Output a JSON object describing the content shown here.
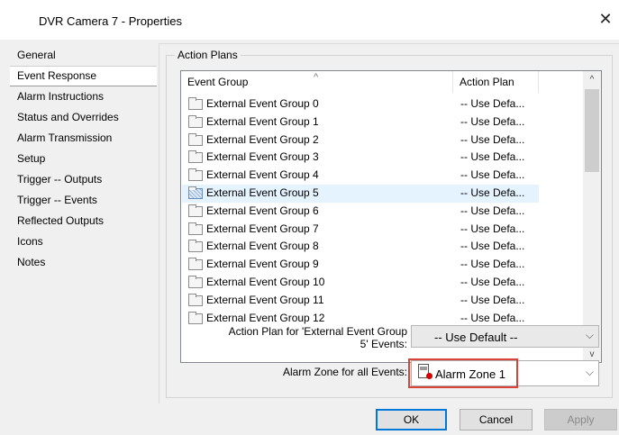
{
  "window": {
    "title": "DVR Camera 7 - Properties",
    "close_label": "✕"
  },
  "nav": {
    "items": [
      {
        "label": "General"
      },
      {
        "label": "Event Response"
      },
      {
        "label": "Alarm Instructions"
      },
      {
        "label": "Status and Overrides"
      },
      {
        "label": "Alarm Transmission"
      },
      {
        "label": "Setup"
      },
      {
        "label": "Trigger -- Outputs"
      },
      {
        "label": "Trigger -- Events"
      },
      {
        "label": "Reflected Outputs"
      },
      {
        "label": "Icons"
      },
      {
        "label": "Notes"
      }
    ],
    "selected": "Event Response"
  },
  "action_plans": {
    "group_title": "Action Plans",
    "columns": {
      "event_group": "Event Group",
      "action_plan": "Action Plan"
    },
    "sort_indicator": "^",
    "rows": [
      {
        "name": "External Event Group 0",
        "plan": "-- Use Defa..."
      },
      {
        "name": "External Event Group 1",
        "plan": "-- Use Defa..."
      },
      {
        "name": "External Event Group 2",
        "plan": "-- Use Defa..."
      },
      {
        "name": "External Event Group 3",
        "plan": "-- Use Defa..."
      },
      {
        "name": "External Event Group 4",
        "plan": "-- Use Defa..."
      },
      {
        "name": "External Event Group 5",
        "plan": "-- Use Defa...",
        "selected": true
      },
      {
        "name": "External Event Group 6",
        "plan": "-- Use Defa..."
      },
      {
        "name": "External Event Group 7",
        "plan": "-- Use Defa..."
      },
      {
        "name": "External Event Group 8",
        "plan": "-- Use Defa..."
      },
      {
        "name": "External Event Group 9",
        "plan": "-- Use Defa..."
      },
      {
        "name": "External Event Group 10",
        "plan": "-- Use Defa..."
      },
      {
        "name": "External Event Group 11",
        "plan": "-- Use Defa..."
      },
      {
        "name": "External Event Group 12",
        "plan": "-- Use Defa..."
      }
    ],
    "scroll_up": "^",
    "scroll_down": "v"
  },
  "action_plan_for": {
    "label_line1": "Action Plan for 'External Event Group",
    "label_line2": "5' Events:",
    "value": "-- Use Default --",
    "arrow": "⌵"
  },
  "alarm_zone": {
    "label": "Alarm Zone for all Events:",
    "value": "Alarm Zone 1",
    "icon": "alarm-zone-icon",
    "arrow": "⌵"
  },
  "highlight_color": "#d9433a",
  "buttons": {
    "ok": "OK",
    "cancel": "Cancel",
    "apply": "Apply"
  }
}
